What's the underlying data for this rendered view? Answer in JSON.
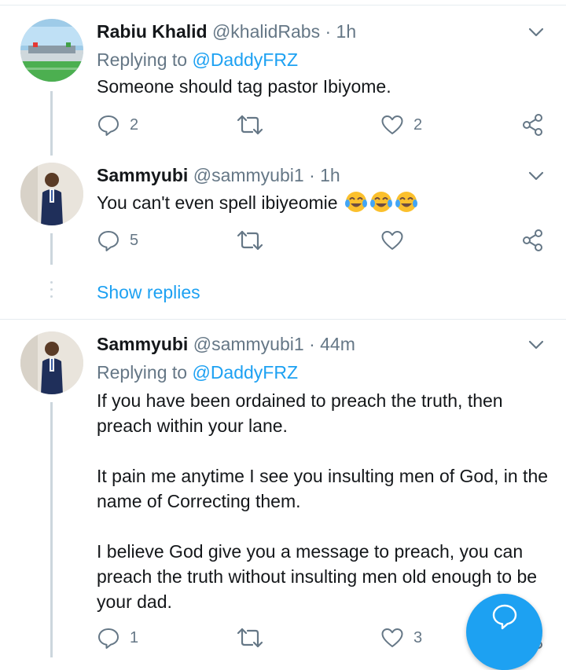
{
  "tweets": [
    {
      "name": "Rabiu Khalid",
      "handle": "@khalidRabs",
      "separator": "·",
      "time": "1h",
      "replying_prefix": "Replying to",
      "replying_to": "@DaddyFRZ",
      "text": [
        "Someone should tag pastor Ibiyome."
      ],
      "reply_count": "2",
      "retweet_count": "",
      "like_count": "2"
    },
    {
      "name": "Sammyubi",
      "handle": "@sammyubi1",
      "separator": "·",
      "time": "1h",
      "text": [
        "You can't even spell ibiyeomie"
      ],
      "emojis": [
        "face-with-tears-of-joy",
        "face-with-tears-of-joy",
        "face-with-tears-of-joy"
      ],
      "reply_count": "5",
      "retweet_count": "",
      "like_count": ""
    },
    {
      "name": "Sammyubi",
      "handle": "@sammyubi1",
      "separator": "·",
      "time": "44m",
      "replying_prefix": "Replying to",
      "replying_to": "@DaddyFRZ",
      "text": [
        "If you have been ordained to preach the truth, then preach within your lane.",
        "It pain me anytime I see you insulting men of God, in the name of Correcting them.",
        "I believe God give you a message to preach, you can preach the truth without insulting men old enough to be your dad."
      ],
      "reply_count": "1",
      "retweet_count": "",
      "like_count": "3"
    }
  ],
  "show_replies_label": "Show replies",
  "icons": {
    "reply": "reply-icon",
    "retweet": "retweet-icon",
    "like": "heart-icon",
    "share": "share-icon",
    "caret": "chevron-down-icon",
    "compose": "compose-reply-icon"
  },
  "colors": {
    "accent": "#1da1f2",
    "secondary_text": "#657786",
    "divider": "#e6ecf0",
    "thread_line": "#ccd6dd"
  }
}
